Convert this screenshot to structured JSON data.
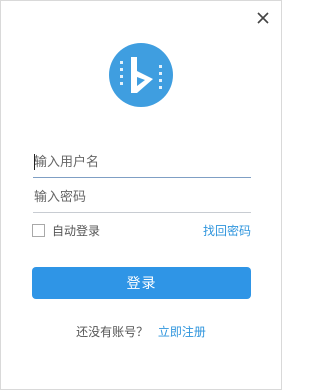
{
  "colors": {
    "accent": "#2f95e6",
    "link": "#2f95dd",
    "logo_blue": "#3f9ee0"
  },
  "icons": {
    "close": "close-icon",
    "logo": "video-play-logo-icon"
  },
  "form": {
    "username_placeholder": "输入用户名",
    "password_placeholder": "输入密码",
    "remember_label": "自动登录",
    "forgot_link": "找回密码",
    "login_button": "登录"
  },
  "footer": {
    "no_account_text": "还没有账号？",
    "register_link": "立即注册"
  }
}
